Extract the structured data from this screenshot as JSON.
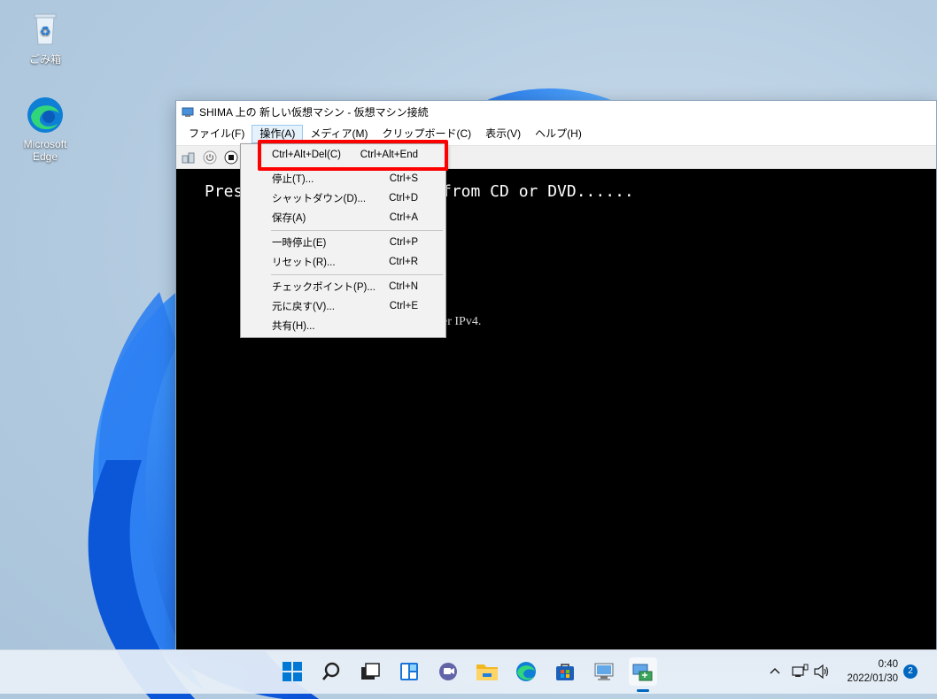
{
  "desktop": {
    "icons": [
      {
        "label": "ごみ箱",
        "icon": "recycle-bin-icon"
      },
      {
        "label": "Microsoft Edge",
        "icon": "edge-icon"
      }
    ]
  },
  "window": {
    "title": "SHIMA 上の 新しい仮想マシン - 仮想マシン接続",
    "menu": [
      "ファイル(F)",
      "操作(A)",
      "メディア(M)",
      "クリップボード(C)",
      "表示(V)",
      "ヘルプ(H)"
    ],
    "open_menu_index": 1,
    "toolbar": [
      "ctrl-alt-del-icon",
      "power-icon",
      "stop-icon"
    ],
    "console": {
      "line_left": "Pres",
      "line_right": "from CD or DVD......",
      "line_small": "er IPv4."
    }
  },
  "dropdown": {
    "items": [
      {
        "label": "Ctrl+Alt+Del(C)",
        "shortcut": "Ctrl+Alt+End",
        "highlighted": true
      },
      {
        "label": "停止(T)...",
        "shortcut": "Ctrl+S"
      },
      {
        "label": "シャットダウン(D)...",
        "shortcut": "Ctrl+D"
      },
      {
        "label": "保存(A)",
        "shortcut": "Ctrl+A"
      },
      {
        "label": "一時停止(E)",
        "shortcut": "Ctrl+P"
      },
      {
        "label": "リセット(R)...",
        "shortcut": "Ctrl+R"
      },
      {
        "label": "チェックポイント(P)...",
        "shortcut": "Ctrl+N"
      },
      {
        "label": "元に戻す(V)...",
        "shortcut": "Ctrl+E"
      },
      {
        "label": "共有(H)...",
        "shortcut": ""
      }
    ]
  },
  "taskbar": {
    "apps": [
      "start-icon",
      "search-icon",
      "task-view-icon",
      "widgets-icon",
      "chat-icon",
      "file-explorer-icon",
      "edge-icon",
      "store-icon",
      "hyperv-manager-icon",
      "vm-connection-icon"
    ],
    "time": "0:40",
    "date": "2022/01/30",
    "notification_count": "2",
    "accent": "#0067c0"
  }
}
